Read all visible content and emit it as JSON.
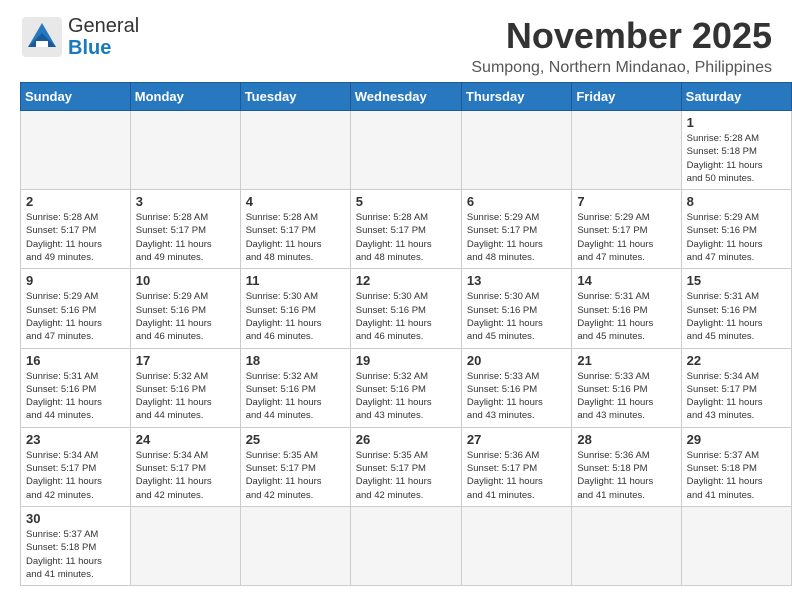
{
  "header": {
    "logo_general": "General",
    "logo_blue": "Blue",
    "month_title": "November 2025",
    "location": "Sumpong, Northern Mindanao, Philippines"
  },
  "weekdays": [
    "Sunday",
    "Monday",
    "Tuesday",
    "Wednesday",
    "Thursday",
    "Friday",
    "Saturday"
  ],
  "days": [
    {
      "num": "",
      "info": ""
    },
    {
      "num": "",
      "info": ""
    },
    {
      "num": "",
      "info": ""
    },
    {
      "num": "",
      "info": ""
    },
    {
      "num": "",
      "info": ""
    },
    {
      "num": "",
      "info": ""
    },
    {
      "num": "1",
      "info": "Sunrise: 5:28 AM\nSunset: 5:18 PM\nDaylight: 11 hours\nand 50 minutes."
    },
    {
      "num": "2",
      "info": "Sunrise: 5:28 AM\nSunset: 5:17 PM\nDaylight: 11 hours\nand 49 minutes."
    },
    {
      "num": "3",
      "info": "Sunrise: 5:28 AM\nSunset: 5:17 PM\nDaylight: 11 hours\nand 49 minutes."
    },
    {
      "num": "4",
      "info": "Sunrise: 5:28 AM\nSunset: 5:17 PM\nDaylight: 11 hours\nand 48 minutes."
    },
    {
      "num": "5",
      "info": "Sunrise: 5:28 AM\nSunset: 5:17 PM\nDaylight: 11 hours\nand 48 minutes."
    },
    {
      "num": "6",
      "info": "Sunrise: 5:29 AM\nSunset: 5:17 PM\nDaylight: 11 hours\nand 48 minutes."
    },
    {
      "num": "7",
      "info": "Sunrise: 5:29 AM\nSunset: 5:17 PM\nDaylight: 11 hours\nand 47 minutes."
    },
    {
      "num": "8",
      "info": "Sunrise: 5:29 AM\nSunset: 5:16 PM\nDaylight: 11 hours\nand 47 minutes."
    },
    {
      "num": "9",
      "info": "Sunrise: 5:29 AM\nSunset: 5:16 PM\nDaylight: 11 hours\nand 47 minutes."
    },
    {
      "num": "10",
      "info": "Sunrise: 5:29 AM\nSunset: 5:16 PM\nDaylight: 11 hours\nand 46 minutes."
    },
    {
      "num": "11",
      "info": "Sunrise: 5:30 AM\nSunset: 5:16 PM\nDaylight: 11 hours\nand 46 minutes."
    },
    {
      "num": "12",
      "info": "Sunrise: 5:30 AM\nSunset: 5:16 PM\nDaylight: 11 hours\nand 46 minutes."
    },
    {
      "num": "13",
      "info": "Sunrise: 5:30 AM\nSunset: 5:16 PM\nDaylight: 11 hours\nand 45 minutes."
    },
    {
      "num": "14",
      "info": "Sunrise: 5:31 AM\nSunset: 5:16 PM\nDaylight: 11 hours\nand 45 minutes."
    },
    {
      "num": "15",
      "info": "Sunrise: 5:31 AM\nSunset: 5:16 PM\nDaylight: 11 hours\nand 45 minutes."
    },
    {
      "num": "16",
      "info": "Sunrise: 5:31 AM\nSunset: 5:16 PM\nDaylight: 11 hours\nand 44 minutes."
    },
    {
      "num": "17",
      "info": "Sunrise: 5:32 AM\nSunset: 5:16 PM\nDaylight: 11 hours\nand 44 minutes."
    },
    {
      "num": "18",
      "info": "Sunrise: 5:32 AM\nSunset: 5:16 PM\nDaylight: 11 hours\nand 44 minutes."
    },
    {
      "num": "19",
      "info": "Sunrise: 5:32 AM\nSunset: 5:16 PM\nDaylight: 11 hours\nand 43 minutes."
    },
    {
      "num": "20",
      "info": "Sunrise: 5:33 AM\nSunset: 5:16 PM\nDaylight: 11 hours\nand 43 minutes."
    },
    {
      "num": "21",
      "info": "Sunrise: 5:33 AM\nSunset: 5:16 PM\nDaylight: 11 hours\nand 43 minutes."
    },
    {
      "num": "22",
      "info": "Sunrise: 5:34 AM\nSunset: 5:17 PM\nDaylight: 11 hours\nand 43 minutes."
    },
    {
      "num": "23",
      "info": "Sunrise: 5:34 AM\nSunset: 5:17 PM\nDaylight: 11 hours\nand 42 minutes."
    },
    {
      "num": "24",
      "info": "Sunrise: 5:34 AM\nSunset: 5:17 PM\nDaylight: 11 hours\nand 42 minutes."
    },
    {
      "num": "25",
      "info": "Sunrise: 5:35 AM\nSunset: 5:17 PM\nDaylight: 11 hours\nand 42 minutes."
    },
    {
      "num": "26",
      "info": "Sunrise: 5:35 AM\nSunset: 5:17 PM\nDaylight: 11 hours\nand 42 minutes."
    },
    {
      "num": "27",
      "info": "Sunrise: 5:36 AM\nSunset: 5:17 PM\nDaylight: 11 hours\nand 41 minutes."
    },
    {
      "num": "28",
      "info": "Sunrise: 5:36 AM\nSunset: 5:18 PM\nDaylight: 11 hours\nand 41 minutes."
    },
    {
      "num": "29",
      "info": "Sunrise: 5:37 AM\nSunset: 5:18 PM\nDaylight: 11 hours\nand 41 minutes."
    },
    {
      "num": "30",
      "info": "Sunrise: 5:37 AM\nSunset: 5:18 PM\nDaylight: 11 hours\nand 41 minutes."
    },
    {
      "num": "",
      "info": ""
    },
    {
      "num": "",
      "info": ""
    },
    {
      "num": "",
      "info": ""
    },
    {
      "num": "",
      "info": ""
    },
    {
      "num": "",
      "info": ""
    },
    {
      "num": "",
      "info": ""
    }
  ]
}
